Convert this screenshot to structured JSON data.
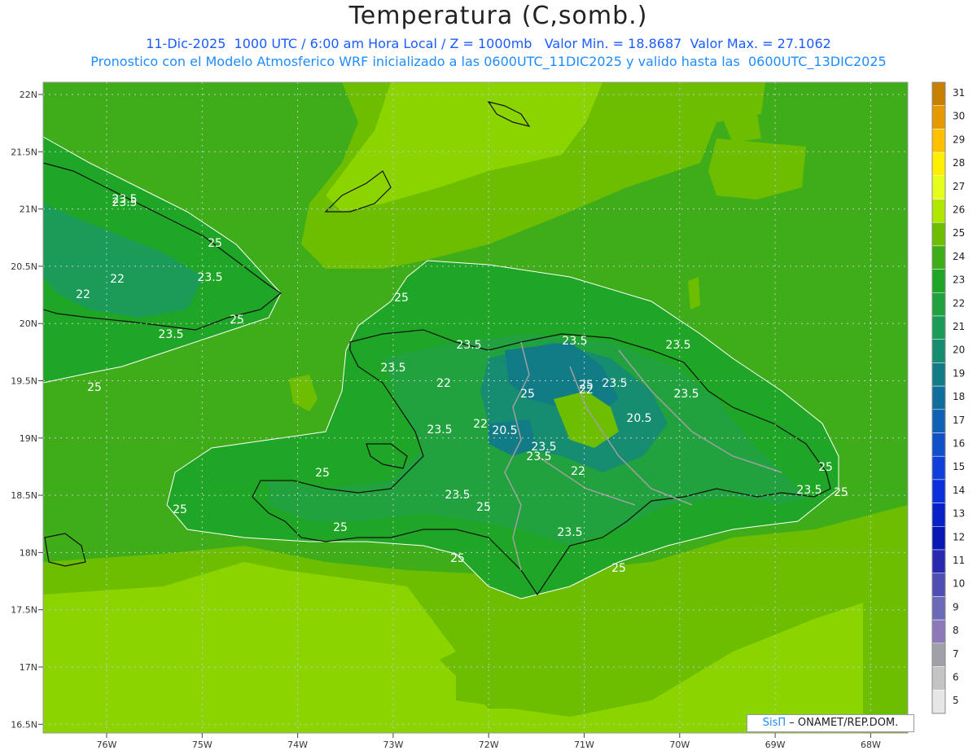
{
  "header": {
    "title": "Temperatura (C,somb.)",
    "line1": "11-Dic-2025  1000 UTC / 6:00 am Hora Local / Z = 1000mb   Valor Min. = 18.8687  Valor Max. = 27.1062",
    "line2": "Pronostico con el Modelo Atmosferico WRF inicializado a las 0600UTC_11DIC2025 y valido hasta las  0600UTC_13DIC2025"
  },
  "axes": {
    "lat_labels": [
      "22N",
      "21.5N",
      "21N",
      "20.5N",
      "20N",
      "19.5N",
      "19N",
      "18.5N",
      "18N",
      "17.5N",
      "17N",
      "16.5N"
    ],
    "lon_labels": [
      "76W",
      "75W",
      "74W",
      "73W",
      "72W",
      "71W",
      "70W",
      "69W",
      "68W"
    ]
  },
  "contour_labels": [
    "23.5",
    "23.5",
    "25",
    "22",
    "23.5",
    "22",
    "25",
    "23.5",
    "25",
    "25",
    "23.5",
    "23.5",
    "23.5",
    "23.5",
    "25",
    "22",
    "22",
    "23.5",
    "22",
    "20.5",
    "20.5",
    "23.5",
    "23.5",
    "23.5",
    "22",
    "25",
    "25",
    "23.5",
    "25",
    "23.5",
    "25",
    "23.5",
    "25",
    "25",
    "25",
    "25",
    "23.5",
    "25"
  ],
  "colorbar": {
    "values": [
      "31",
      "30",
      "29",
      "28",
      "27",
      "26",
      "25",
      "24",
      "23",
      "22",
      "21",
      "20",
      "19",
      "18",
      "17",
      "16",
      "15",
      "14",
      "13",
      "12",
      "11",
      "10",
      "9",
      "8",
      "7",
      "6",
      "5"
    ],
    "colors": [
      "#c88000",
      "#e49a00",
      "#ffc000",
      "#ffef00",
      "#e6ff1a",
      "#b0e600",
      "#6dbd00",
      "#3fad1a",
      "#20a626",
      "#22a23e",
      "#1a9c58",
      "#168c70",
      "#127c86",
      "#106e9c",
      "#1060b4",
      "#1050c8",
      "#1040dc",
      "#0a30dc",
      "#0820c8",
      "#0818b4",
      "#2828b0",
      "#4e4eb4",
      "#6a6ab8",
      "#8c7ab8",
      "#a0a0a8",
      "#c4c4c4",
      "#e6e6e6"
    ]
  },
  "credit": {
    "brand": "SisΠ",
    "text": " – ONAMET/REP.DOM."
  }
}
